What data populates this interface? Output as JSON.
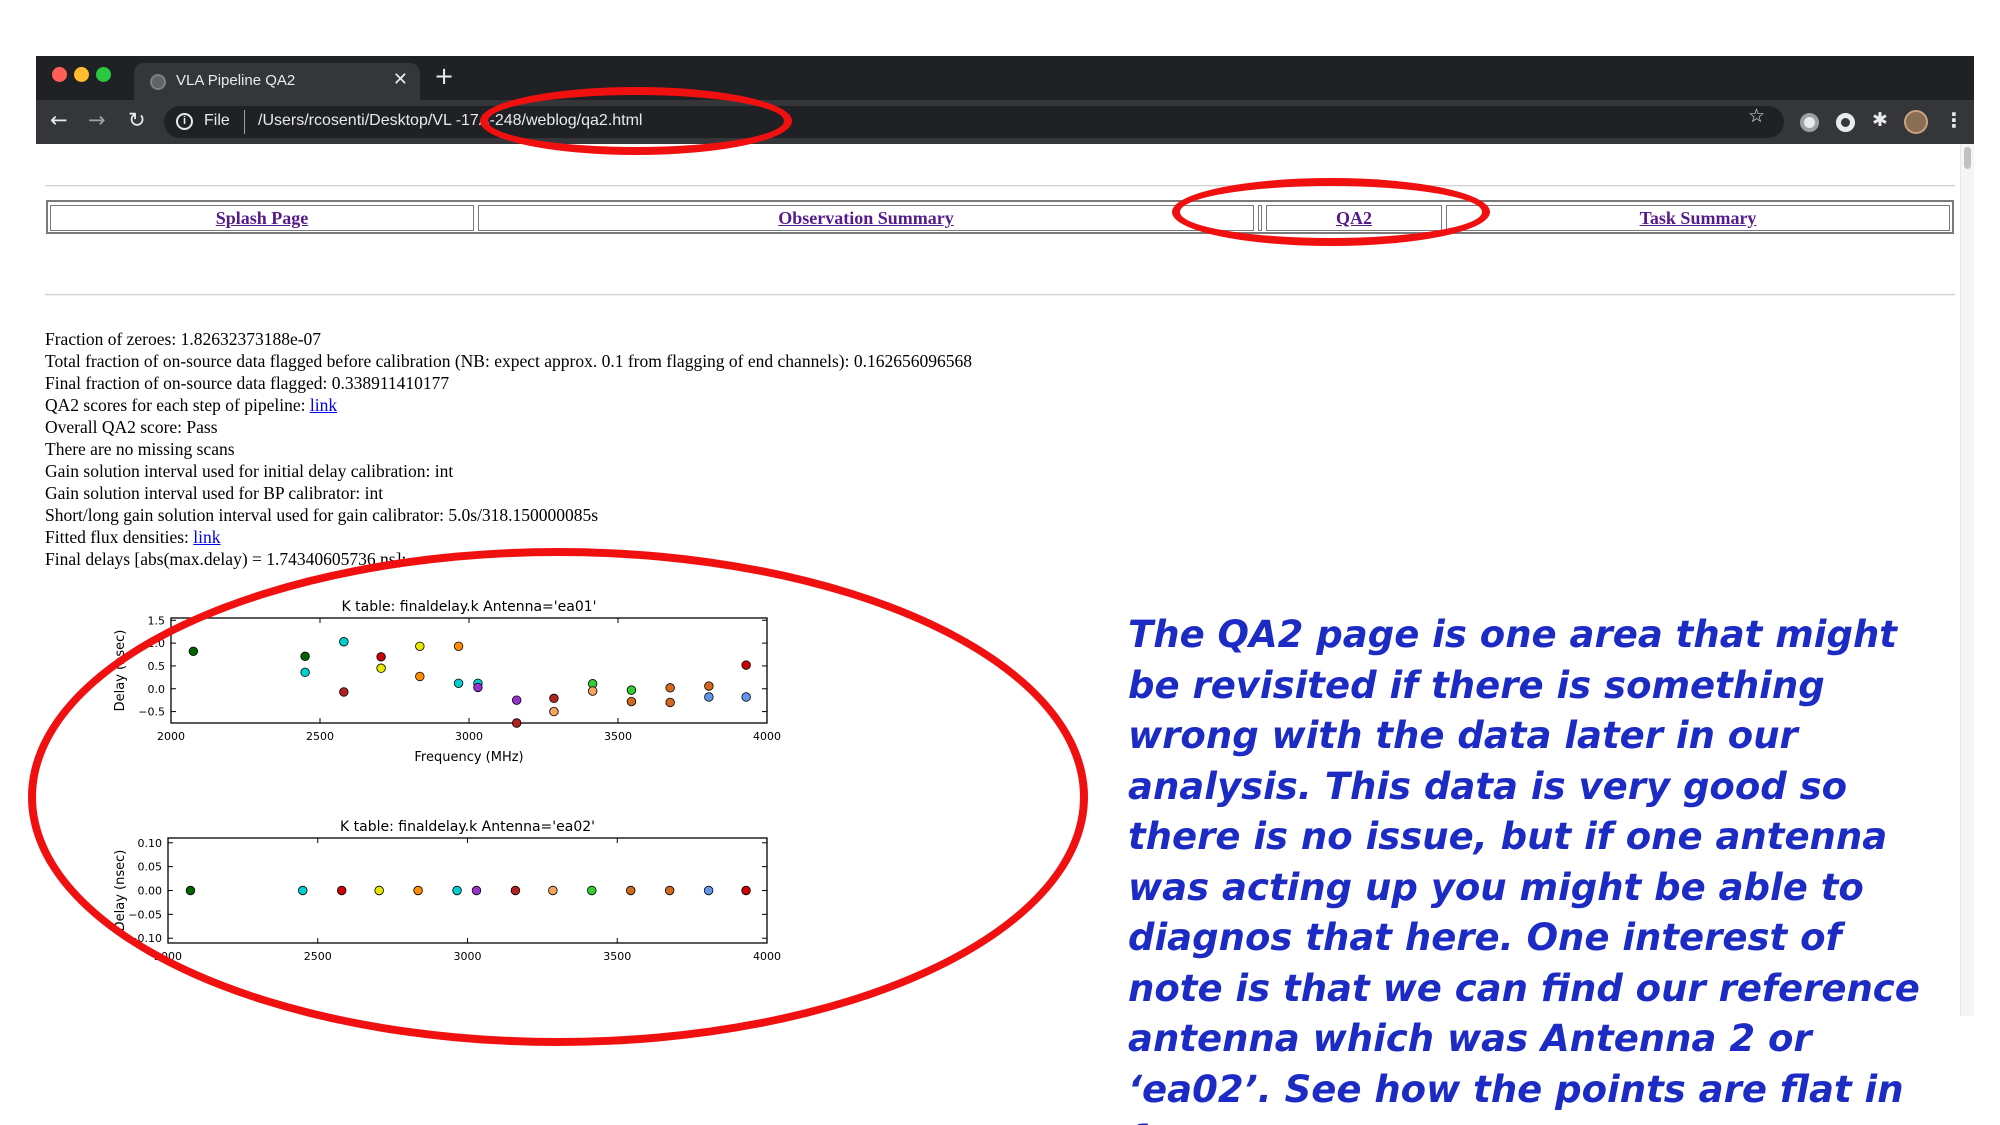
{
  "browser": {
    "tab_title": "VLA Pipeline QA2",
    "tab_close": "✕",
    "new_tab": "+",
    "url_scheme": "File",
    "url": "/Users/rcosenti/Desktop/VL -17A-248/weblog/qa2.html"
  },
  "nav": {
    "splash": "Splash Page",
    "observation": "Observation Summary",
    "qa2": "QA2",
    "task": "Task Summary"
  },
  "qa2_info": {
    "zeros": "Fraction of zeroes: 1.82632373188e-07",
    "flag_before": "Total fraction of on-source data flagged before calibration (NB: expect approx. 0.1 from flagging of end channels): 0.162656096568",
    "flag_final": "Final fraction of on-source data flagged: 0.338911410177",
    "scores_prefix": "QA2 scores for each step of pipeline: ",
    "scores_link": "link",
    "overall": "Overall QA2 score: Pass",
    "missing": "There are no missing scans",
    "gain_delay": "Gain solution interval used for initial delay calibration: int",
    "gain_bp": "Gain solution interval used for BP calibrator: int",
    "gain_short_long": "Short/long gain solution interval used for gain calibrator: 5.0s/318.150000085s",
    "flux_prefix": "Fitted flux densities: ",
    "flux_link": "link",
    "final_delays": "Final delays [abs(max.delay) = 1.74340605736 ns]:"
  },
  "chart_data": [
    {
      "type": "scatter",
      "title": "K table: finaldelay.k     Antenna='ea01'",
      "xlabel": "Frequency (MHz)",
      "ylabel": "Delay (nsec)",
      "xlim": [
        2000,
        4000
      ],
      "ylim": [
        -0.75,
        1.55
      ],
      "xticks": [
        "2000",
        "2500",
        "3000",
        "3500",
        "4000"
      ],
      "yticks": [
        "1.5",
        "1.0",
        "0.5",
        "0.0",
        "−0.5"
      ],
      "ytick_values": [
        1.5,
        1.0,
        0.5,
        0.0,
        -0.5
      ],
      "points": [
        {
          "x": 2075,
          "y": 0.82,
          "color": "#006400"
        },
        {
          "x": 2450,
          "y": 0.71,
          "color": "#006400"
        },
        {
          "x": 2450,
          "y": 0.36,
          "color": "#00ced1"
        },
        {
          "x": 2580,
          "y": 1.03,
          "color": "#00ced1"
        },
        {
          "x": 2580,
          "y": -0.07,
          "color": "#b22222"
        },
        {
          "x": 2705,
          "y": 0.7,
          "color": "#cc0000"
        },
        {
          "x": 2705,
          "y": 0.45,
          "color": "#e6e600"
        },
        {
          "x": 2835,
          "y": 0.93,
          "color": "#e6e600"
        },
        {
          "x": 2835,
          "y": 0.27,
          "color": "#ff8c00"
        },
        {
          "x": 2965,
          "y": 0.93,
          "color": "#ff8c00"
        },
        {
          "x": 2965,
          "y": 0.12,
          "color": "#00ced1"
        },
        {
          "x": 3030,
          "y": 0.12,
          "color": "#00ced1"
        },
        {
          "x": 3030,
          "y": 0.03,
          "color": "#9932cc"
        },
        {
          "x": 3160,
          "y": -0.25,
          "color": "#9932cc"
        },
        {
          "x": 3160,
          "y": -0.75,
          "color": "#b22222"
        },
        {
          "x": 3285,
          "y": -0.21,
          "color": "#b22222"
        },
        {
          "x": 3285,
          "y": -0.5,
          "color": "#f4a460"
        },
        {
          "x": 3415,
          "y": 0.11,
          "color": "#32cd32"
        },
        {
          "x": 3415,
          "y": -0.05,
          "color": "#f4a460"
        },
        {
          "x": 3545,
          "y": -0.03,
          "color": "#32cd32"
        },
        {
          "x": 3545,
          "y": -0.28,
          "color": "#d2691e"
        },
        {
          "x": 3675,
          "y": 0.02,
          "color": "#d2691e"
        },
        {
          "x": 3675,
          "y": -0.3,
          "color": "#d2691e"
        },
        {
          "x": 3805,
          "y": 0.06,
          "color": "#d2691e"
        },
        {
          "x": 3805,
          "y": -0.18,
          "color": "#6495ed"
        },
        {
          "x": 3930,
          "y": 0.52,
          "color": "#cc0000"
        },
        {
          "x": 3930,
          "y": -0.18,
          "color": "#6495ed"
        }
      ]
    },
    {
      "type": "scatter",
      "title": "K table: finaldelay.k     Antenna='ea02'",
      "xlabel": "",
      "ylabel": "Delay (nsec)",
      "xlim": [
        2000,
        4000
      ],
      "ylim": [
        -0.11,
        0.11
      ],
      "xticks": [
        "2000",
        "2500",
        "3000",
        "3500",
        "4000"
      ],
      "yticks": [
        "0.10",
        "0.05",
        "0.00",
        "−0.05",
        "−0.10"
      ],
      "ytick_values": [
        0.1,
        0.05,
        0.0,
        -0.05,
        -0.1
      ],
      "points": [
        {
          "x": 2075,
          "y": 0.0,
          "color": "#006400"
        },
        {
          "x": 2450,
          "y": 0.0,
          "color": "#00ced1"
        },
        {
          "x": 2580,
          "y": 0.0,
          "color": "#cc0000"
        },
        {
          "x": 2705,
          "y": 0.0,
          "color": "#e6e600"
        },
        {
          "x": 2835,
          "y": 0.0,
          "color": "#ff8c00"
        },
        {
          "x": 2965,
          "y": 0.0,
          "color": "#00ced1"
        },
        {
          "x": 3030,
          "y": 0.0,
          "color": "#9932cc"
        },
        {
          "x": 3160,
          "y": 0.0,
          "color": "#b22222"
        },
        {
          "x": 3285,
          "y": 0.0,
          "color": "#f4a460"
        },
        {
          "x": 3415,
          "y": 0.0,
          "color": "#32cd32"
        },
        {
          "x": 3545,
          "y": 0.0,
          "color": "#d2691e"
        },
        {
          "x": 3675,
          "y": 0.0,
          "color": "#d2691e"
        },
        {
          "x": 3805,
          "y": 0.0,
          "color": "#6495ed"
        },
        {
          "x": 3930,
          "y": 0.0,
          "color": "#cc0000"
        }
      ]
    }
  ],
  "annotation": {
    "caption": "The QA2 page is one area that might be revisited if there is something wrong with the data later in our analysis. This data is very good so there is no issue, but if one antenna was acting up you might be able to diagnos that here. One interest of note is that we can find our reference antenna which was Antenna 2 or ‘ea02’. See how the points are flat in frequency.",
    "ellipse_color": "#f01010",
    "caption_color": "#1c2bc4"
  }
}
